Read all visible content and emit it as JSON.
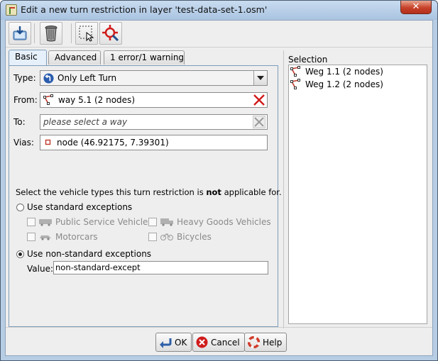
{
  "window": {
    "title": "Edit a new turn restriction in layer 'test-data-set-1.osm'",
    "close_glyph": "✕"
  },
  "toolbar": {
    "buttons": [
      {
        "name": "apply-icon"
      },
      {
        "name": "delete-icon"
      },
      {
        "name": "select-icon"
      },
      {
        "name": "zoom-to-icon"
      }
    ]
  },
  "tabs": [
    "Basic",
    "Advanced",
    "1 error/1 warning"
  ],
  "form": {
    "type_label": "Type:",
    "type_value": "Only Left Turn",
    "from_label": "From:",
    "from_value": "way 5.1 (2 nodes)",
    "to_label": "To:",
    "to_placeholder": "please select a way",
    "vias_label": "Vias:",
    "vias_value": "node (46.92175, 7.39301)",
    "note_prefix": "Select the vehicle types this turn restriction is ",
    "note_bold": "not",
    "note_suffix": " applicable for.",
    "std_label": "Use standard exceptions",
    "std_options": [
      "Public Service Vehicle",
      "Heavy Goods Vehicles",
      "Motorcars",
      "Bicycles"
    ],
    "nonstd_label": "Use non-standard exceptions",
    "value_label": "Value:",
    "value_value": "non-standard-except"
  },
  "selection": {
    "title": "Selection",
    "items": [
      "Weg 1.1 (2 nodes)",
      "Weg 1.2 (2 nodes)"
    ]
  },
  "buttons": {
    "ok": "OK",
    "cancel": "Cancel",
    "help": "Help"
  },
  "colors": {
    "accent_blue": "#2f5fa8",
    "delete_red": "#d01b1b",
    "way_red": "#c0392b"
  }
}
